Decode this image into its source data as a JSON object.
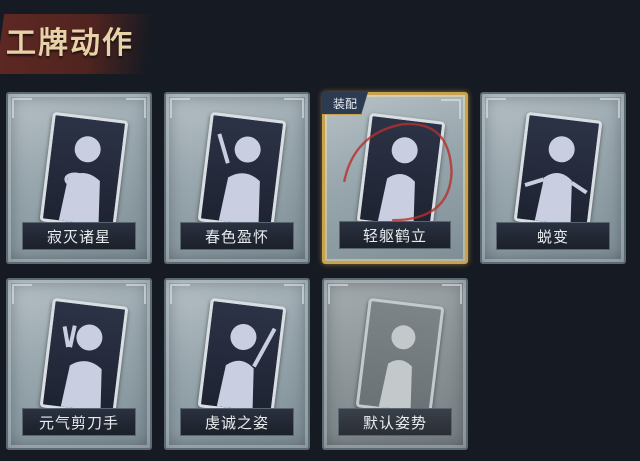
{
  "header": {
    "title": "工牌动作"
  },
  "cards": [
    {
      "label": "寂灭诸星",
      "equipped": false,
      "muted": false
    },
    {
      "label": "春色盈怀",
      "equipped": false,
      "muted": false
    },
    {
      "label": "轻躯鹤立",
      "equipped": true,
      "badge": "装配",
      "muted": false
    },
    {
      "label": "蜕变",
      "equipped": false,
      "muted": false
    },
    {
      "label": "元气剪刀手",
      "equipped": false,
      "muted": false
    },
    {
      "label": "虔诚之姿",
      "equipped": false,
      "muted": false
    },
    {
      "label": "默认姿势",
      "equipped": false,
      "muted": true
    }
  ],
  "colors": {
    "accent_gold": "#c9a24d",
    "header_red": "#6a2a22",
    "bg": "#161a22"
  }
}
